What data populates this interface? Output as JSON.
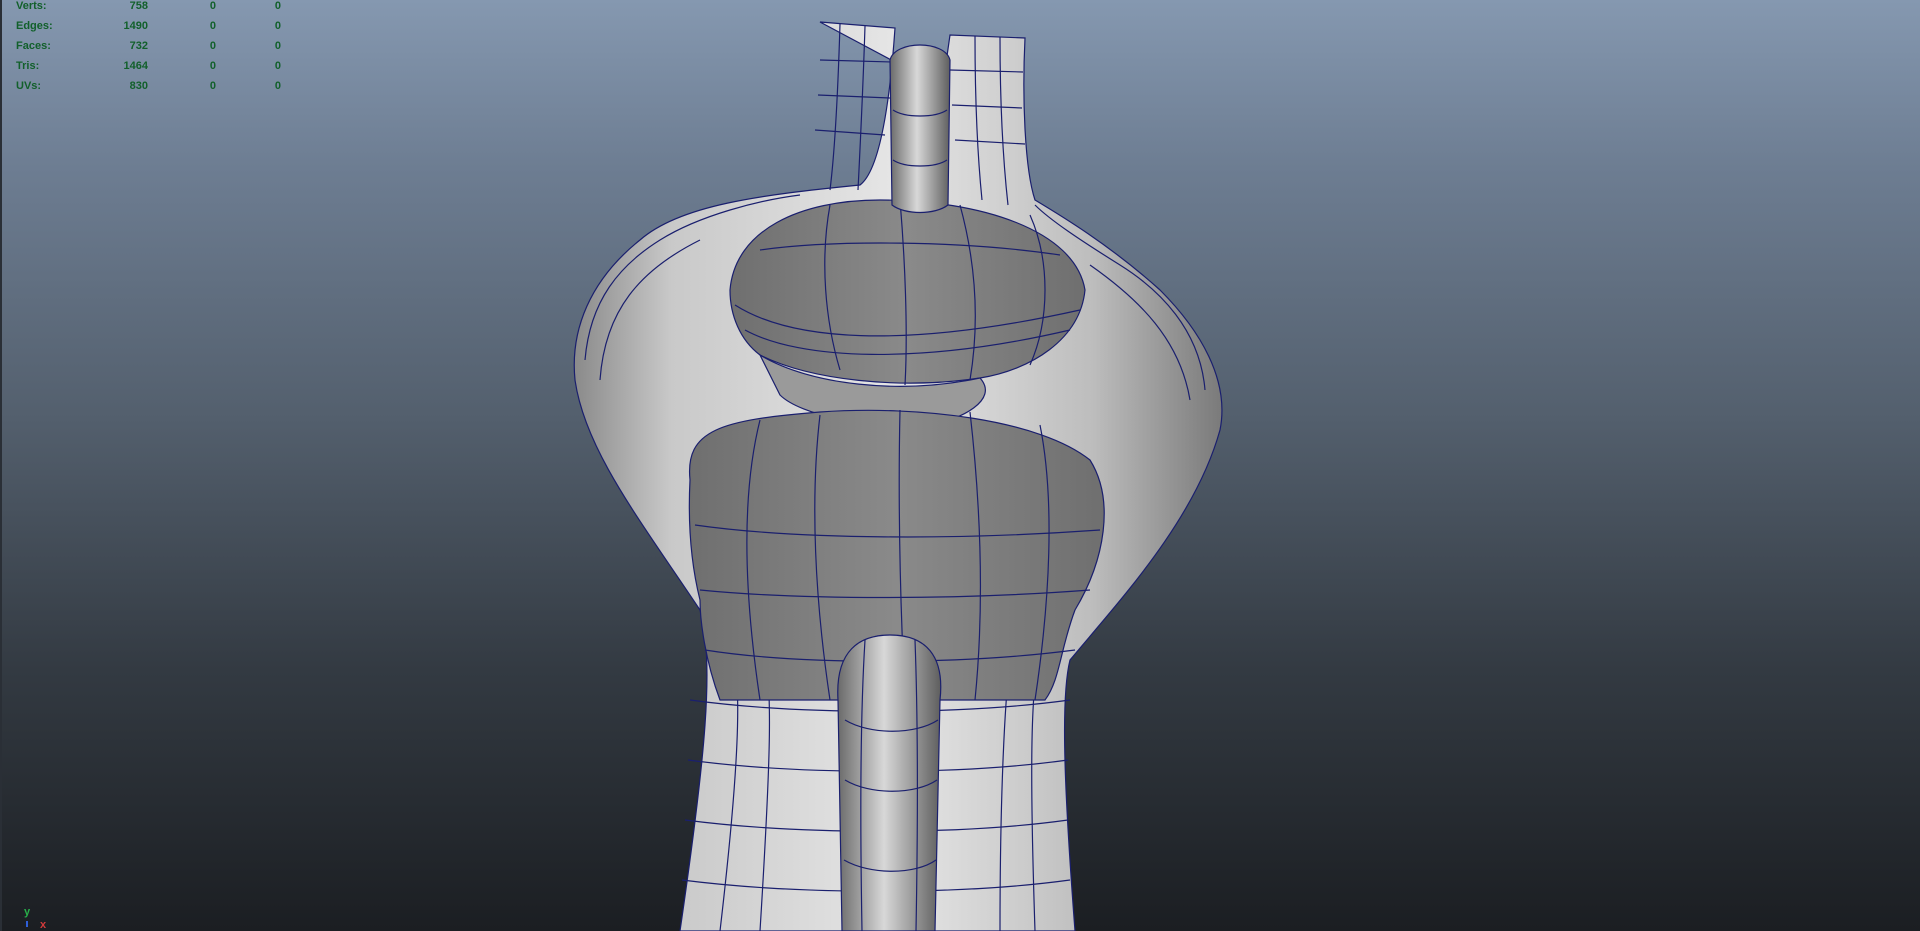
{
  "hud": {
    "rows": [
      {
        "label": "Verts:",
        "v1": "758",
        "v2": "0",
        "v3": "0"
      },
      {
        "label": "Edges:",
        "v1": "1490",
        "v2": "0",
        "v3": "0"
      },
      {
        "label": "Faces:",
        "v1": "732",
        "v2": "0",
        "v3": "0"
      },
      {
        "label": "Tris:",
        "v1": "1464",
        "v2": "0",
        "v3": "0"
      },
      {
        "label": "UVs:",
        "v1": "830",
        "v2": "0",
        "v3": "0"
      }
    ],
    "text_color": "#12602b"
  },
  "axis": {
    "y_label": "y",
    "x_label": "x",
    "y_color": "#28b04a",
    "x_color": "#d23b3b"
  },
  "colors": {
    "wire": "#1a1f6e",
    "surface_light": "#e0e0e0",
    "surface_dark": "#7d7d7d"
  }
}
